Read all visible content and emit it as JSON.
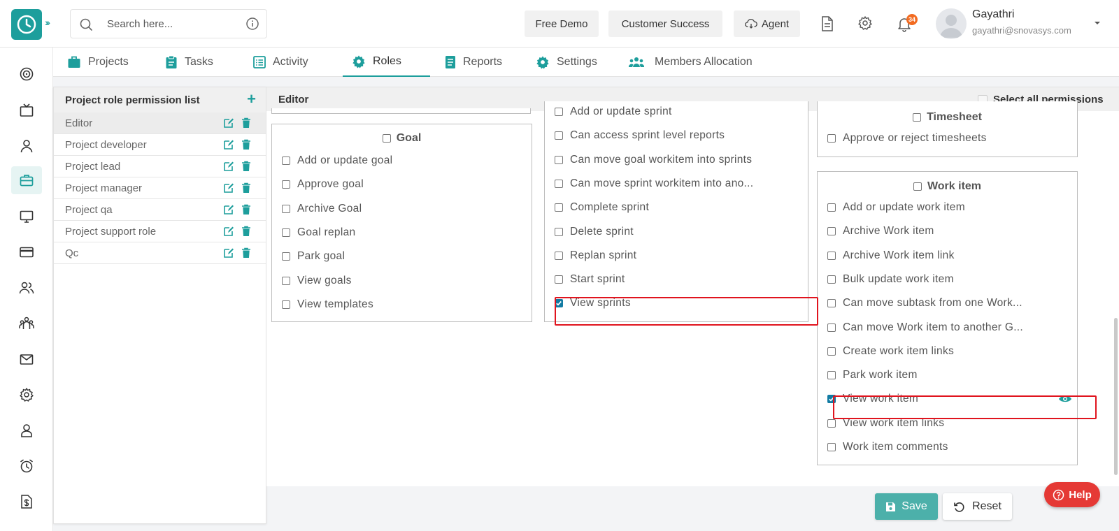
{
  "header": {
    "search_placeholder": "Search here...",
    "buttons": {
      "free_demo": "Free Demo",
      "customer_success": "Customer Success",
      "agent": "Agent"
    },
    "notification_count": "34",
    "user": {
      "name": "Gayathri",
      "email": "gayathri@snovasys.com"
    }
  },
  "tabs": [
    {
      "label": "Projects",
      "icon": "briefcase-icon"
    },
    {
      "label": "Tasks",
      "icon": "clipboard-icon"
    },
    {
      "label": "Activity",
      "icon": "list-icon"
    },
    {
      "label": "Roles",
      "icon": "gear-icon",
      "active": true
    },
    {
      "label": "Reports",
      "icon": "report-icon"
    },
    {
      "label": "Settings",
      "icon": "gear-icon"
    },
    {
      "label": "Members Allocation",
      "icon": "people-icon"
    }
  ],
  "roles_panel": {
    "title": "Project role permission list",
    "roles": [
      "Editor",
      "Project developer",
      "Project lead",
      "Project manager",
      "Project qa",
      "Project support role",
      "Qc"
    ],
    "selected": "Editor"
  },
  "main": {
    "title": "Editor",
    "select_all": "Select all permissions",
    "goal": {
      "title": "Goal",
      "items": [
        "Add or update goal",
        "Approve goal",
        "Archive Goal",
        "Goal replan",
        "Park goal",
        "View goals",
        "View templates"
      ]
    },
    "sprint": {
      "items": [
        {
          "label": "Add or update sprint",
          "checked": false
        },
        {
          "label": "Can access sprint level reports",
          "checked": false
        },
        {
          "label": "Can move goal workitem into sprints",
          "checked": false
        },
        {
          "label": "Can move sprint workitem into ano...",
          "checked": false
        },
        {
          "label": "Complete sprint",
          "checked": false
        },
        {
          "label": "Delete sprint",
          "checked": false
        },
        {
          "label": "Replan sprint",
          "checked": false
        },
        {
          "label": "Start sprint",
          "checked": false
        },
        {
          "label": "View sprints",
          "checked": true
        }
      ]
    },
    "timesheet": {
      "title": "Timesheet",
      "items": [
        "Approve or reject timesheets"
      ]
    },
    "work_item": {
      "title": "Work item",
      "items": [
        {
          "label": "Add or update work item",
          "checked": false
        },
        {
          "label": "Archive Work item",
          "checked": false
        },
        {
          "label": "Archive Work item link",
          "checked": false
        },
        {
          "label": "Bulk update work item",
          "checked": false
        },
        {
          "label": "Can move subtask from one Work...",
          "checked": false
        },
        {
          "label": "Can move Work item to another G...",
          "checked": false
        },
        {
          "label": "Create work item links",
          "checked": false
        },
        {
          "label": "Park work item",
          "checked": false
        },
        {
          "label": "View work item",
          "checked": true
        },
        {
          "label": "View work item links",
          "checked": false
        },
        {
          "label": "Work item comments",
          "checked": false
        }
      ]
    }
  },
  "footer": {
    "save": "Save",
    "reset": "Reset",
    "help": "Help"
  },
  "colors": {
    "accent": "#1d9e9c",
    "checkbox_checked": "#127ba3",
    "highlight": "#e0141e",
    "help": "#e53935"
  }
}
